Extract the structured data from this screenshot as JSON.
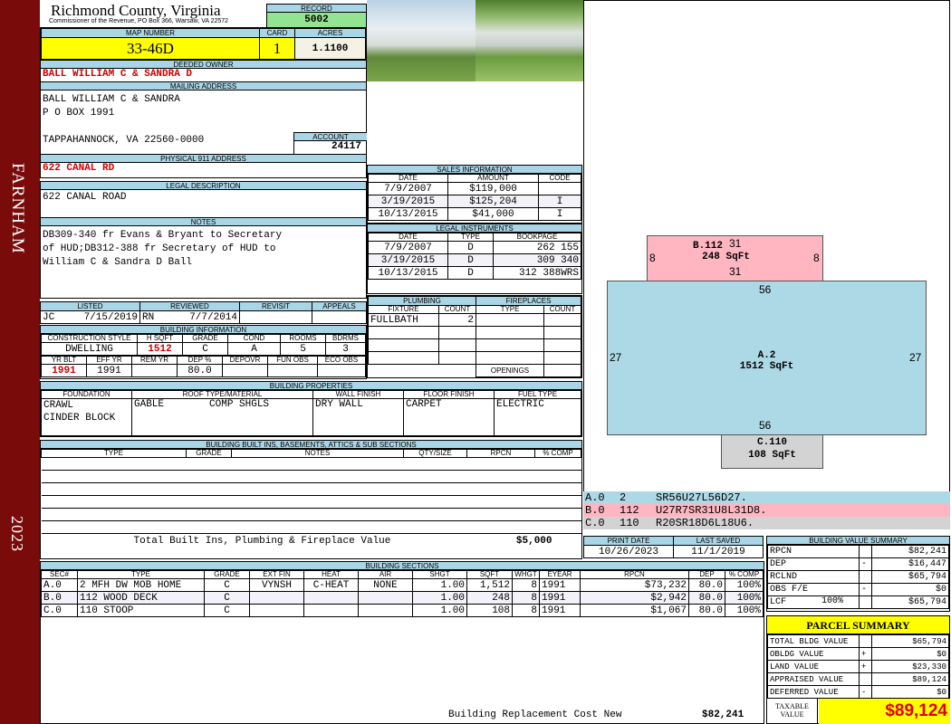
{
  "sidebar": {
    "town": "FARNHAM",
    "year": "2023"
  },
  "header": {
    "title": "Richmond County, Virginia",
    "subtitle": "Commissioner of the Revenue, PO Box 366, Warsaw, VA 22572",
    "record_label": "RECORD",
    "record": "5002"
  },
  "parcel": {
    "map_label": "MAP NUMBER",
    "map": "33-46D",
    "card_label": "CARD",
    "card": "1",
    "acres_label": "ACRES",
    "acres": "1.1100"
  },
  "owner": {
    "label": "DEEDED OWNER",
    "name": "BALL WILLIAM C & SANDRA D"
  },
  "mailing": {
    "label": "MAILING ADDRESS",
    "line1": "BALL WILLIAM C & SANDRA",
    "line2": "P O BOX 1991",
    "line3": "TAPPAHANNOCK, VA 22560-0000",
    "account_label": "ACCOUNT",
    "account": "24117"
  },
  "physical": {
    "label": "PHYSICAL 911 ADDRESS",
    "value": "622 CANAL RD"
  },
  "legal": {
    "label": "LEGAL DESCRIPTION",
    "value": "622 CANAL ROAD"
  },
  "notes": {
    "label": "NOTES",
    "lines": [
      "DB309-340 fr Evans & Bryant to Secretary",
      "of HUD;DB312-388 fr Secretary of HUD to",
      "William C & Sandra D Ball"
    ]
  },
  "review": {
    "listed_label": "LISTED",
    "reviewed_label": "REVIEWED",
    "revisit_label": "REVISIT",
    "appeals_label": "APPEALS",
    "listed_by": "JC",
    "listed_date": "7/15/2019",
    "reviewed_by": "RN",
    "reviewed_date": "7/7/2014"
  },
  "bldg_info": {
    "label": "BUILDING INFORMATION",
    "h": [
      "CONSTRUCTION STYLE",
      "H SQFT",
      "GRADE",
      "COND",
      "ROOMS",
      "BDRMS"
    ],
    "v": [
      "DWELLING",
      "1512",
      "C",
      "A",
      "5",
      "3"
    ],
    "h2": [
      "YR BLT",
      "EFF YR",
      "REM YR",
      "DEP %",
      "DEPOVR",
      "FUN OBS",
      "ECO OBS"
    ],
    "v2": [
      "1991",
      "1991",
      "",
      "80.0",
      "",
      "",
      ""
    ]
  },
  "bldg_props": {
    "label": "BUILDING PROPERTIES",
    "h": [
      "FOUNDATION",
      "ROOF TYPE/MATERIAL",
      "WALL FINISH",
      "FLOOR FINISH",
      "FUEL TYPE"
    ],
    "foundation": [
      "CRAWL",
      "CINDER BLOCK"
    ],
    "roof_type": "GABLE",
    "roof_material": "COMP SHGLS",
    "wall": "DRY WALL",
    "floor": "CARPET",
    "fuel": "ELECTRIC"
  },
  "builtins": {
    "label": "BUILDING BUILT INS, BASEMENTS, ATTICS & SUB SECTIONS",
    "h": [
      "TYPE",
      "GRADE",
      "NOTES",
      "QTY/SIZE",
      "RPCN",
      "% COMP"
    ],
    "total_label": "Total Built Ins, Plumbing & Fireplace Value",
    "total": "$5,000"
  },
  "sales": {
    "label": "SALES INFORMATION",
    "h": [
      "DATE",
      "AMOUNT",
      "CODE"
    ],
    "rows": [
      {
        "date": "7/9/2007",
        "amount": "$119,000",
        "code": ""
      },
      {
        "date": "3/19/2015",
        "amount": "$125,204",
        "code": "I"
      },
      {
        "date": "10/13/2015",
        "amount": "$41,000",
        "code": "I"
      }
    ]
  },
  "instruments": {
    "label": "LEGAL INSTRUMENTS",
    "h": [
      "DATE",
      "TYPE",
      "BOOKPAGE"
    ],
    "rows": [
      {
        "date": "7/9/2007",
        "type": "D",
        "bp": "262 155"
      },
      {
        "date": "3/19/2015",
        "type": "D",
        "bp": "309 340"
      },
      {
        "date": "10/13/2015",
        "type": "D",
        "bp": "312 388WRS"
      }
    ]
  },
  "plumbing": {
    "label": "PLUMBING",
    "h": [
      "FIXTURE",
      "COUNT"
    ],
    "fixture": "FULLBATH",
    "count": "2"
  },
  "fireplaces": {
    "label": "FIREPLACES",
    "h": [
      "TYPE",
      "COUNT"
    ],
    "openings_label": "OPENINGS"
  },
  "sketch": {
    "b_label": "B.112",
    "b_area": "248 SqFt",
    "b_top": "31",
    "b_bottom": "31",
    "b_left": "8",
    "b_right": "8",
    "a_label": "A.2",
    "a_area": "1512 SqFt",
    "a_top": "56",
    "a_bottom": "56",
    "a_left": "27",
    "a_right": "27",
    "c_label": "C.110",
    "c_area": "108 SqFt",
    "colors": {
      "a": "#add8e6",
      "b": "#ffb6c1",
      "c": "#d3d3d3"
    }
  },
  "sketch_legend": [
    {
      "sec": "A.0",
      "code": "2",
      "path": "SR56U27L56D27."
    },
    {
      "sec": "B.0",
      "code": "112",
      "path": "U27R7SR31U8L31D8."
    },
    {
      "sec": "C.0",
      "code": "110",
      "path": "R20SR18D6L18U6."
    }
  ],
  "dates": {
    "print_label": "PRINT DATE",
    "print": "10/26/2023",
    "saved_label": "LAST SAVED",
    "saved": "11/1/2019"
  },
  "sections": {
    "label": "BUILDING SECTIONS",
    "h": [
      "SEC#",
      "TYPE",
      "GRADE",
      "EXT FIN",
      "HEAT",
      "AIR",
      "SHGT",
      "SQFT",
      "WHGT",
      "EYEAR",
      "RPCN",
      "DEP",
      "% COMP"
    ],
    "rows": [
      {
        "sec": "A.0",
        "type": "2 MFH DW MOB HOME",
        "grade": "C",
        "ext": "VYNSH",
        "heat": "C-HEAT",
        "air": "NONE",
        "shgt": "1.00",
        "sqft": "1,512",
        "whgt": "8",
        "eyear": "1991",
        "rpcn": "$73,232",
        "dep": "80.0",
        "comp": "100%"
      },
      {
        "sec": "B.0",
        "type": "112 WOOD DECK",
        "grade": "C",
        "ext": "",
        "heat": "",
        "air": "",
        "shgt": "1.00",
        "sqft": "248",
        "whgt": "8",
        "eyear": "1991",
        "rpcn": "$2,942",
        "dep": "80.0",
        "comp": "100%"
      },
      {
        "sec": "C.0",
        "type": "110 STOOP",
        "grade": "C",
        "ext": "",
        "heat": "",
        "air": "",
        "shgt": "1.00",
        "sqft": "108",
        "whgt": "8",
        "eyear": "1991",
        "rpcn": "$1,067",
        "dep": "80.0",
        "comp": "100%"
      }
    ],
    "total_label": "Building Replacement Cost New",
    "total": "$82,241"
  },
  "value_summary": {
    "label": "BUILDING VALUE SUMMARY",
    "rows": [
      {
        "k": "RPCN",
        "s": "",
        "v": "$82,241"
      },
      {
        "k": "DEP",
        "s": "-",
        "v": "$16,447"
      },
      {
        "k": "RCLND",
        "s": "",
        "v": "$65,794"
      },
      {
        "k": "OBS F/E",
        "s": "-",
        "v": "$0"
      },
      {
        "k": "LCF",
        "p": "100%",
        "s": "",
        "v": "$65,794"
      }
    ]
  },
  "parcel_summary": {
    "label": "PARCEL SUMMARY",
    "rows": [
      {
        "k": "TOTAL BLDG VALUE",
        "s": "",
        "v": "$65,794"
      },
      {
        "k": "OBLDG VALUE",
        "s": "+",
        "v": "$0"
      },
      {
        "k": "LAND VALUE",
        "s": "+",
        "v": "$23,330"
      },
      {
        "k": "APPRAISED VALUE",
        "s": "",
        "v": "$89,124"
      },
      {
        "k": "DEFERRED VALUE",
        "s": "-",
        "v": "$0"
      }
    ],
    "taxable_label": "TAXABLE VALUE",
    "taxable": "$89,124"
  }
}
